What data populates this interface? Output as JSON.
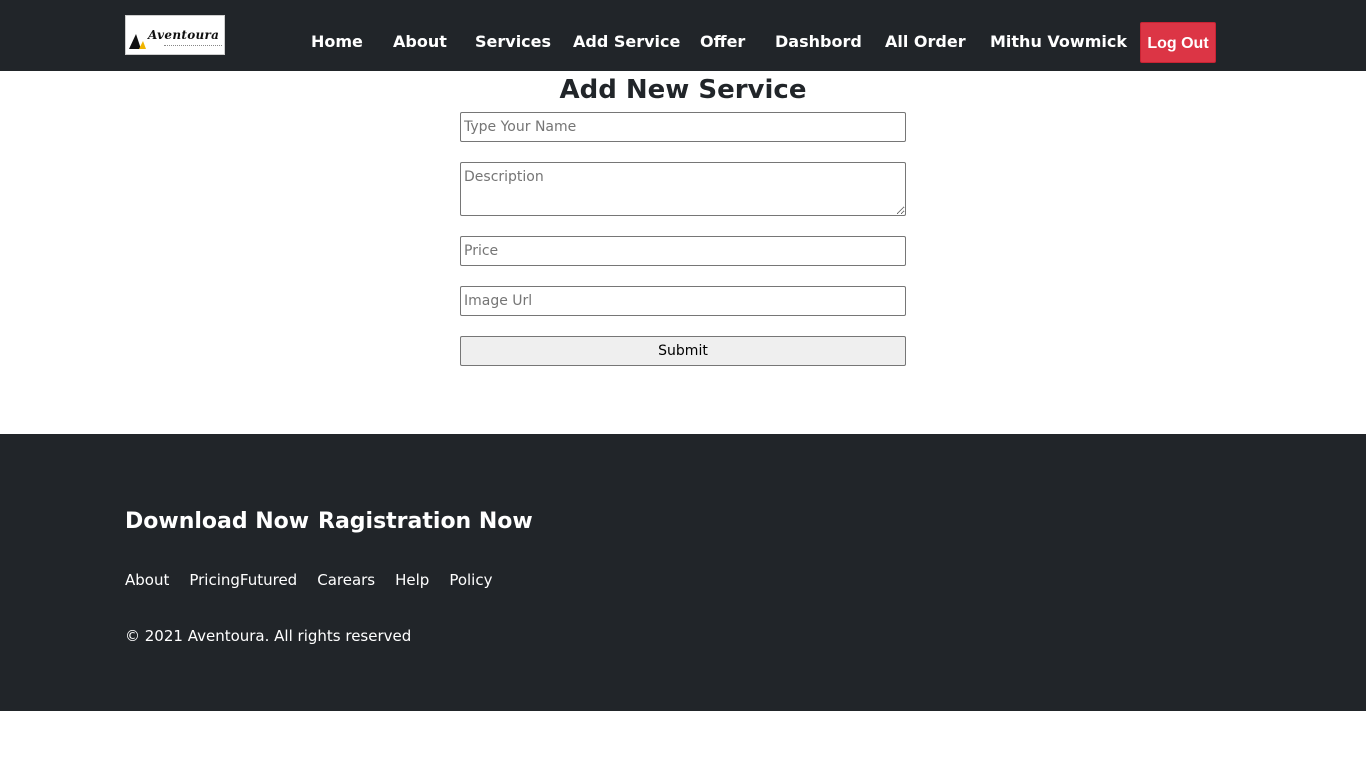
{
  "brand": {
    "logo_text": "Aventoura",
    "logo_icon": "mountain-icon"
  },
  "nav": {
    "items": [
      {
        "label": "Home"
      },
      {
        "label": "About"
      },
      {
        "label": "Services"
      },
      {
        "label": "Add Service"
      },
      {
        "label": "Offer"
      },
      {
        "label": "Dashbord"
      },
      {
        "label": "All Order"
      },
      {
        "label": "Mithu Vowmick"
      }
    ],
    "logout_label": "Log Out"
  },
  "form": {
    "title": "Add New Service",
    "name_placeholder": "Type Your Name",
    "description_placeholder": "Description",
    "price_placeholder": "Price",
    "image_placeholder": "Image Url",
    "submit_label": "Submit"
  },
  "footer": {
    "cta_download": "Download Now",
    "cta_register": "Ragistration Now",
    "links": [
      {
        "label": "About"
      },
      {
        "label": "PricingFutured"
      },
      {
        "label": "Carears"
      },
      {
        "label": "Help"
      },
      {
        "label": "Policy"
      }
    ],
    "copyright": "© 2021 Aventoura. All rights reserved"
  },
  "colors": {
    "navbar_bg": "#212529",
    "footer_bg": "#212529",
    "logout_bg": "#dc3545",
    "text_light": "#ffffff"
  }
}
